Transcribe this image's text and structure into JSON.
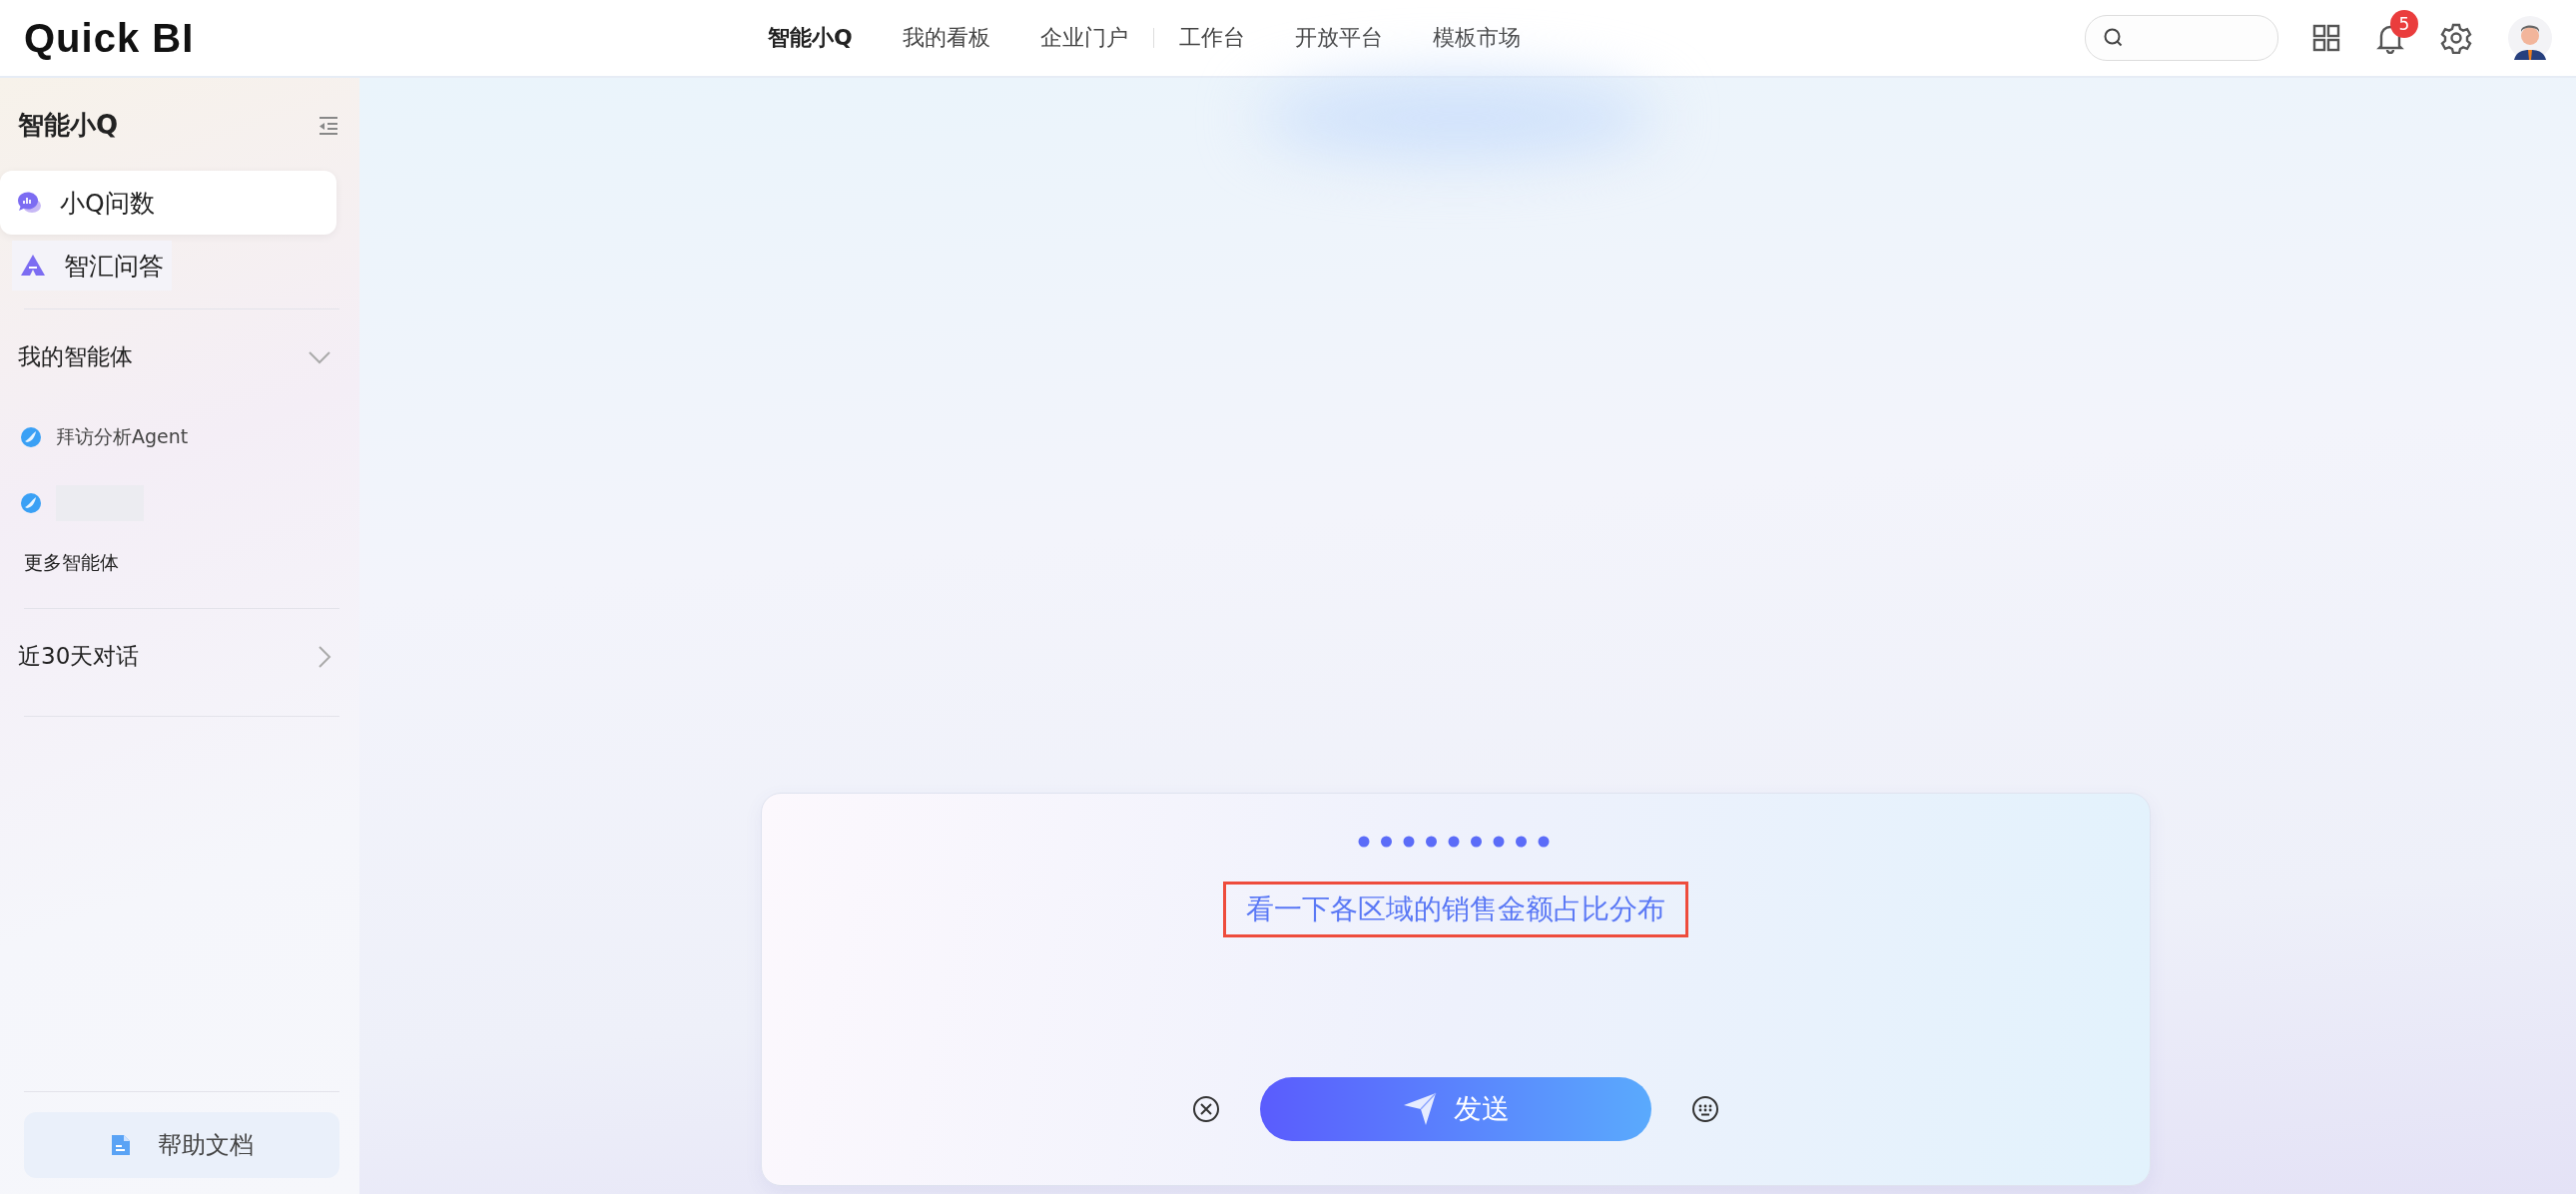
{
  "header": {
    "logo": "Quick BI",
    "nav": [
      {
        "label": "智能小Q",
        "selected": true
      },
      {
        "label": "我的看板",
        "selected": false
      },
      {
        "label": "企业门户",
        "selected": false,
        "divider_after": true
      },
      {
        "label": "工作台",
        "selected": false
      },
      {
        "label": "开放平台",
        "selected": false
      },
      {
        "label": "模板市场",
        "selected": false
      }
    ],
    "notification_count": "5"
  },
  "sidebar": {
    "title": "智能小Q",
    "items": [
      {
        "label": "小Q问数",
        "selected": true,
        "kind": "chat"
      },
      {
        "label": "智汇问答",
        "selected": false,
        "kind": "triangle"
      }
    ],
    "agents": {
      "title": "我的智能体",
      "expanded": true,
      "items": [
        {
          "kind": "named",
          "label": "拜访分析Agent"
        },
        {
          "kind": "redacted"
        }
      ],
      "more": "更多智能体"
    },
    "history": {
      "title": "近30天对话",
      "expanded": false
    },
    "help": "帮助文档"
  },
  "composer": {
    "question": "看一下各区域的销售金额占比分布",
    "highlighted": true,
    "send": "发送"
  }
}
